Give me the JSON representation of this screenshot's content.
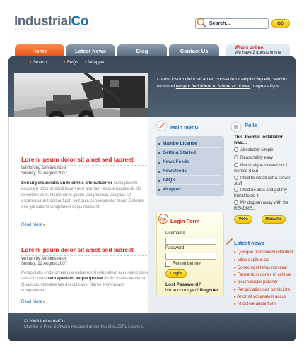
{
  "brand": {
    "part1": "Industrial",
    "part2": "Co"
  },
  "search": {
    "value": "Search...",
    "go_label": "GO"
  },
  "tabs": [
    {
      "label": "Home"
    },
    {
      "label": "Latest News"
    },
    {
      "label": "Blog"
    },
    {
      "label": "Contact Us"
    }
  ],
  "online": {
    "title": "Who's online:",
    "text": "We have 2 guests online"
  },
  "subnav": [
    "Search",
    "FAQ's",
    "Wrapper"
  ],
  "hero": {
    "text_before": "Lorem ipsum dolor sit amet, consectetur adipisicing elit, sed do eiusmod ",
    "link_text": "tempor incididunt ut labore et dolore",
    "text_after": " magna aliqua."
  },
  "articles": [
    {
      "title": "Lorem ipsum dolor sit amet sed laoreet",
      "author": "Written by Administrator",
      "date": "Sunday, 12 August 2007",
      "body_bold": "Sed ut perspiciatis unde omnis iste natuerror",
      "body": " sivoluptatem accusant dolor audanti totam rem aperiam, eaque ipquae ab illo inventore verit. Nemo enim ipsam voluptateuia voluptas sit aspernatur aut odit aufugit, sed quia consequuntur magn.Dolores eos qui ratione voluptatem sequi nesciunt.",
      "read_more": "Read More"
    },
    {
      "title": "Lorem ipsum dolor sit amet sed laoreet",
      "author": "Written by Administrator",
      "date": "Sunday, 12 August 2007",
      "body_pre": "Perspiciatis unde omnis iste natuerror sivoluptatem accu-santi dolor audanti totam ",
      "body_bold": "rem aperiam, eaque ipquae",
      "body_post": " ab illo inventore veritat. Quasi architebatae tae di explicabo. Nemo enim ipsam voluptateuia.",
      "read_more": "Read More"
    }
  ],
  "main_menu": {
    "title": "Main menu",
    "items": [
      "Mambo License",
      "Getting Started",
      "News Feeds",
      "Newsfeeds",
      "FAQ's",
      "Wrapper"
    ]
  },
  "login": {
    "title": "Login Form",
    "username_label": "Username",
    "password_label": "Password",
    "remember_label": "Remember me",
    "button": "Login",
    "lost": "Lost Password?",
    "no_account": "No account yet?",
    "register": "Register"
  },
  "polls": {
    "title": "Polls",
    "question": "This Joomla! installation was....",
    "options": [
      "Absolutely simple",
      "Reasonably easy",
      "Not straight-forward but I worked it out",
      "I had to install extra server stuff",
      "I had no idea and got my friend to do it",
      "My dog ran away with the README..."
    ],
    "vote": "Vote",
    "results": "Results"
  },
  "latest_news": {
    "title": "Latest news",
    "items": [
      "Quisque diam lorem interdum",
      "Vitae dapibus ac",
      "Donec eget tellus non erat",
      "Fermentum donec in velit vel",
      "Ipsum auctor pulvinar",
      "Perspiciatis unde omnis iste",
      "Arror sit voluptatem accus",
      "Nt dolore audantium"
    ]
  },
  "footer": {
    "line1": "© 2008 IndustrialCo.",
    "line2": "Mambo is Free Software released under the GNU/GPL License."
  },
  "colors": {
    "accent": "#e02020",
    "brand_blue": "#1d6fb8",
    "tab_active": "#ee5c1f",
    "band": "#445566",
    "button_yellow": "#f7d51c"
  }
}
